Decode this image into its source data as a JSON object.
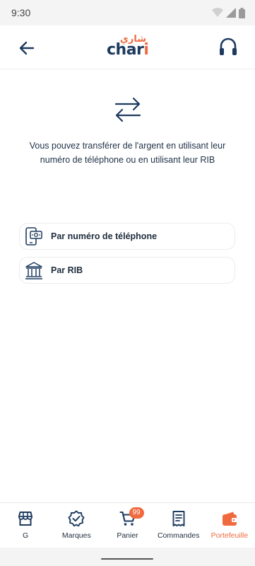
{
  "status_bar": {
    "time": "9:30"
  },
  "header": {
    "logo_arabic": "شاري",
    "logo_latin_main": "char",
    "logo_latin_accent": "i"
  },
  "intro": {
    "text": "Vous pouvez transférer de l'argent en utilisant leur numéro de téléphone ou en utilisant leur RIB"
  },
  "options": [
    {
      "label": "Par numéro de téléphone",
      "icon": "phone-cash-icon"
    },
    {
      "label": "Par RIB",
      "icon": "bank-icon"
    }
  ],
  "bottom_nav": {
    "items": [
      {
        "label": "G",
        "icon": "store-icon",
        "active": false
      },
      {
        "label": "Marques",
        "icon": "verified-badge-icon",
        "active": false
      },
      {
        "label": "Panier",
        "icon": "cart-icon",
        "badge": "99",
        "active": false
      },
      {
        "label": "Commandes",
        "icon": "receipt-icon",
        "active": false
      },
      {
        "label": "Portefeuille",
        "icon": "wallet-icon",
        "active": true
      }
    ]
  },
  "colors": {
    "accent": "#f06a3f",
    "primary": "#1d3a5f"
  }
}
